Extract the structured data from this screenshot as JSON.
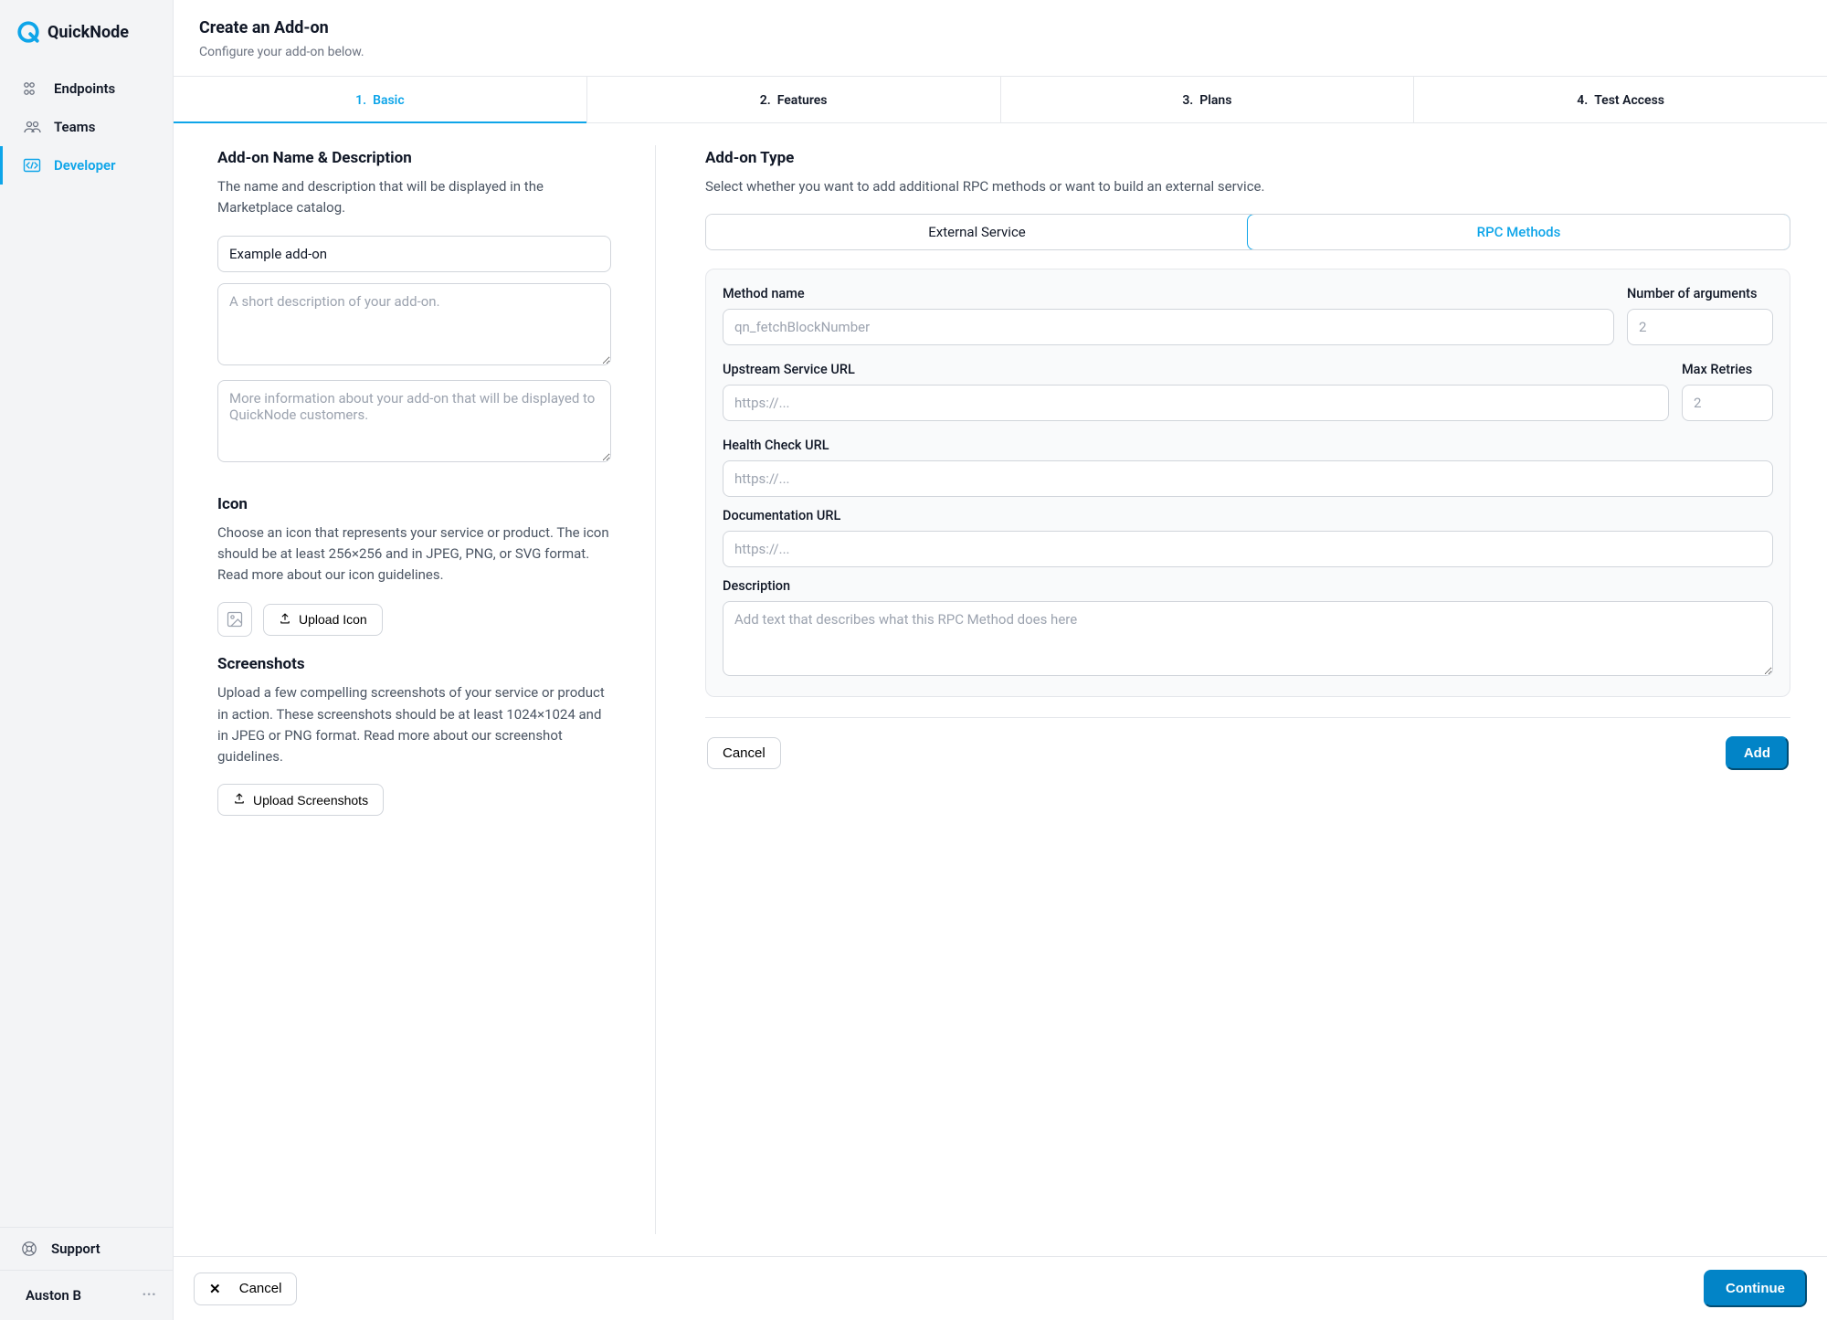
{
  "brand": "QuickNode",
  "sidebar": {
    "items": [
      {
        "label": "Endpoints"
      },
      {
        "label": "Teams"
      },
      {
        "label": "Developer"
      }
    ],
    "support": "Support",
    "user": "Auston B"
  },
  "header": {
    "title": "Create an Add-on",
    "subtitle": "Configure your add-on below."
  },
  "tabs": [
    {
      "num": "1.",
      "label": "Basic"
    },
    {
      "num": "2.",
      "label": "Features"
    },
    {
      "num": "3.",
      "label": "Plans"
    },
    {
      "num": "4.",
      "label": "Test Access"
    }
  ],
  "left": {
    "name_section": {
      "title": "Add-on Name & Description",
      "sub": "The name and description that will be displayed in the Marketplace catalog.",
      "name_value": "Example add-on",
      "short_placeholder": "A short description of your add-on.",
      "long_placeholder": "More information about your add-on that will be displayed to QuickNode customers."
    },
    "icon_section": {
      "title": "Icon",
      "sub": "Choose an icon that represents your service or product. The icon should be at least 256×256 and in JPEG, PNG, or SVG format. Read more about our icon guidelines.",
      "upload_label": "Upload Icon"
    },
    "screenshots_section": {
      "title": "Screenshots",
      "sub": "Upload a few compelling screenshots of your service or product in action. These screenshots should be at least 1024×1024 and in JPEG or PNG format. Read more about our screenshot guidelines.",
      "upload_label": "Upload Screenshots"
    }
  },
  "right": {
    "title": "Add-on Type",
    "sub": "Select whether you want to add additional RPC methods or want to build an external service.",
    "segmented": {
      "external": "External Service",
      "rpc": "RPC Methods"
    },
    "form": {
      "method_name_label": "Method name",
      "method_name_placeholder": "qn_fetchBlockNumber",
      "num_args_label": "Number of arguments",
      "num_args_placeholder": "2",
      "upstream_label": "Upstream Service URL",
      "upstream_placeholder": "https://...",
      "retries_label": "Max Retries",
      "retries_placeholder": "2",
      "health_label": "Health Check URL",
      "health_placeholder": "https://...",
      "docs_label": "Documentation URL",
      "docs_placeholder": "https://...",
      "desc_label": "Description",
      "desc_placeholder": "Add text that describes what this RPC Method does here",
      "cancel": "Cancel",
      "add": "Add"
    }
  },
  "footer": {
    "cancel": "Cancel",
    "continue": "Continue"
  }
}
